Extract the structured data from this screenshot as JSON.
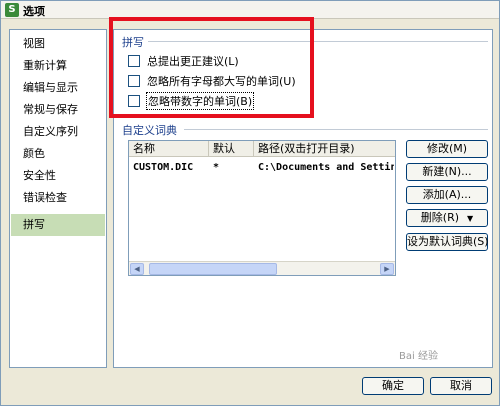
{
  "window": {
    "title": "选项",
    "app_icon_letter": "S"
  },
  "sidebar": {
    "items": [
      {
        "label": "视图"
      },
      {
        "label": "重新计算"
      },
      {
        "label": "编辑与显示"
      },
      {
        "label": "常规与保存"
      },
      {
        "label": "自定义序列"
      },
      {
        "label": "颜色"
      },
      {
        "label": "安全性"
      },
      {
        "label": "错误检查"
      },
      {
        "label": "拼写",
        "active": true
      }
    ]
  },
  "spelling": {
    "group_label": "拼写",
    "options": [
      {
        "label": "总提出更正建议(L)",
        "checked": false
      },
      {
        "label": "忽略所有字母都大写的单词(U)",
        "checked": false
      },
      {
        "label": "忽略带数字的单词(B)",
        "checked": false
      }
    ]
  },
  "dictionary": {
    "group_label": "自定义词典",
    "columns": [
      "名称",
      "默认",
      "路径(双击打开目录)"
    ],
    "rows": [
      {
        "name": "CUSTOM.DIC",
        "default": "*",
        "path": "C:\\Documents and Settings"
      }
    ],
    "buttons": {
      "modify": "修改(M)",
      "new": "新建(N)...",
      "add": "添加(A)...",
      "delete": "删除(R)",
      "set_default": "设为默认词典(S)"
    }
  },
  "footer": {
    "ok": "确定",
    "cancel": "取消"
  },
  "watermark": "Bai 经验"
}
